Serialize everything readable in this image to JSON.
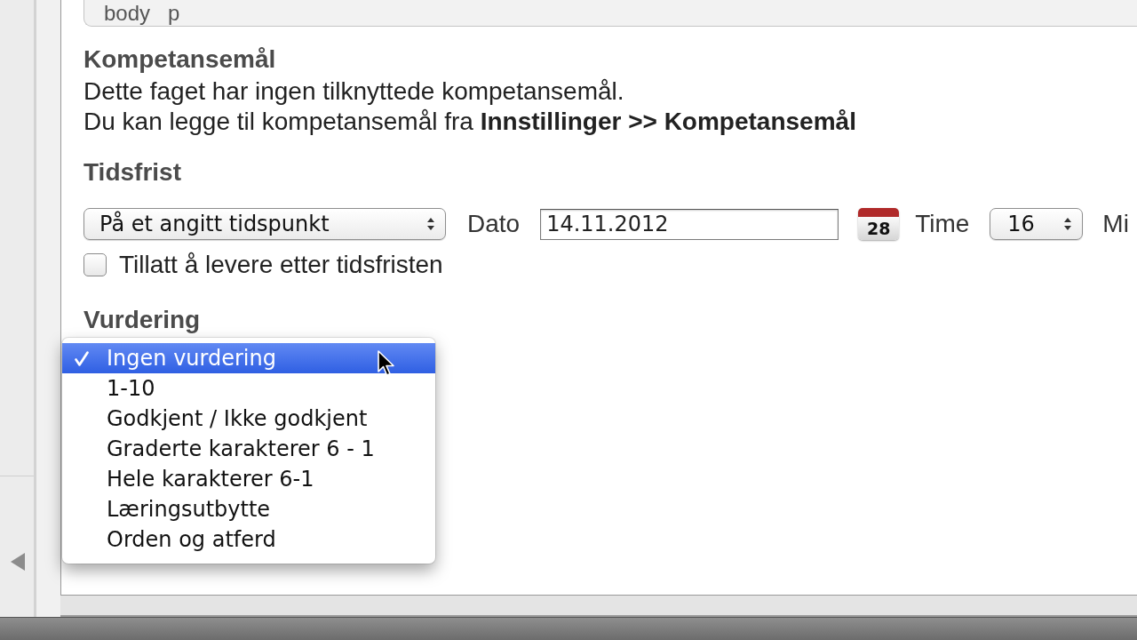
{
  "path_bar": {
    "items": [
      "body",
      "p"
    ]
  },
  "competence_goals": {
    "heading": "Kompetansemål",
    "lines": [
      "Dette faget har ingen tilknyttede kompetansemål.",
      "Du kan legge til kompetansemål fra **Innstillinger >> Kompetansemål**"
    ]
  },
  "deadline": {
    "heading": "Tidsfrist",
    "mode_select": {
      "value": "På et angitt tidspunkt"
    },
    "date": {
      "label": "Dato",
      "value": "14.11.2012"
    },
    "calendar_button": {
      "day": "28"
    },
    "hour": {
      "label": "Time",
      "value": "16"
    },
    "minute": {
      "label": "Mi"
    },
    "allow_late": {
      "label": "Tillatt å levere etter tidsfristen",
      "checked": false
    }
  },
  "assessment": {
    "heading": "Vurdering",
    "menu": {
      "items": [
        {
          "label": "Ingen vurdering",
          "selected": true
        },
        {
          "label": "1-10",
          "selected": false
        },
        {
          "label": "Godkjent / Ikke godkjent",
          "selected": false
        },
        {
          "label": "Graderte karakterer 6 - 1",
          "selected": false
        },
        {
          "label": "Hele karakterer 6-1",
          "selected": false
        },
        {
          "label": "Læringsutbytte",
          "selected": false
        },
        {
          "label": "Orden og atferd",
          "selected": false
        }
      ]
    }
  }
}
